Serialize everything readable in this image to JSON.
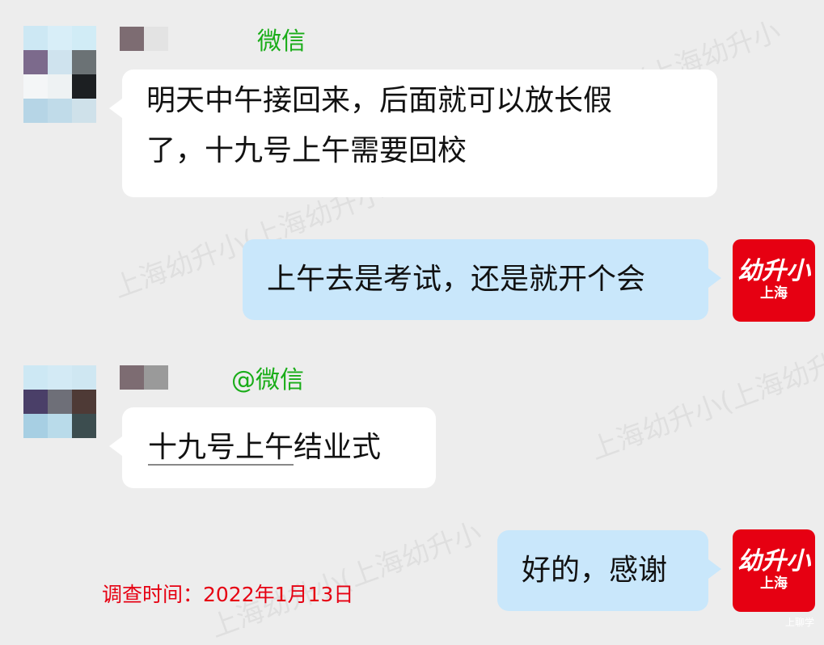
{
  "watermark_text": "上海幼升小(上海幼升小",
  "messages": [
    {
      "sender_suffix": "微信",
      "text_line1": "明天中午接回来，后面就可以放长假",
      "text_line2": "了，十九号上午需要回校"
    },
    {
      "text": "上午去是考试，还是就开个会"
    },
    {
      "sender_suffix": "@微信",
      "text_part1": "十九号上午",
      "text_part2": "结业式"
    },
    {
      "text": "好的，感谢"
    }
  ],
  "brand_avatar": {
    "line1": "幼升小",
    "line2": "上海",
    "color": "#e60012"
  },
  "survey_time": "调查时间：2022年1月13日",
  "corner_mark": "上聊学",
  "colors": {
    "background": "#ededed",
    "left_bubble": "#ffffff",
    "right_bubble": "#c9e7fb",
    "sender_tag": "#1aad19",
    "survey_text": "#e60012"
  }
}
